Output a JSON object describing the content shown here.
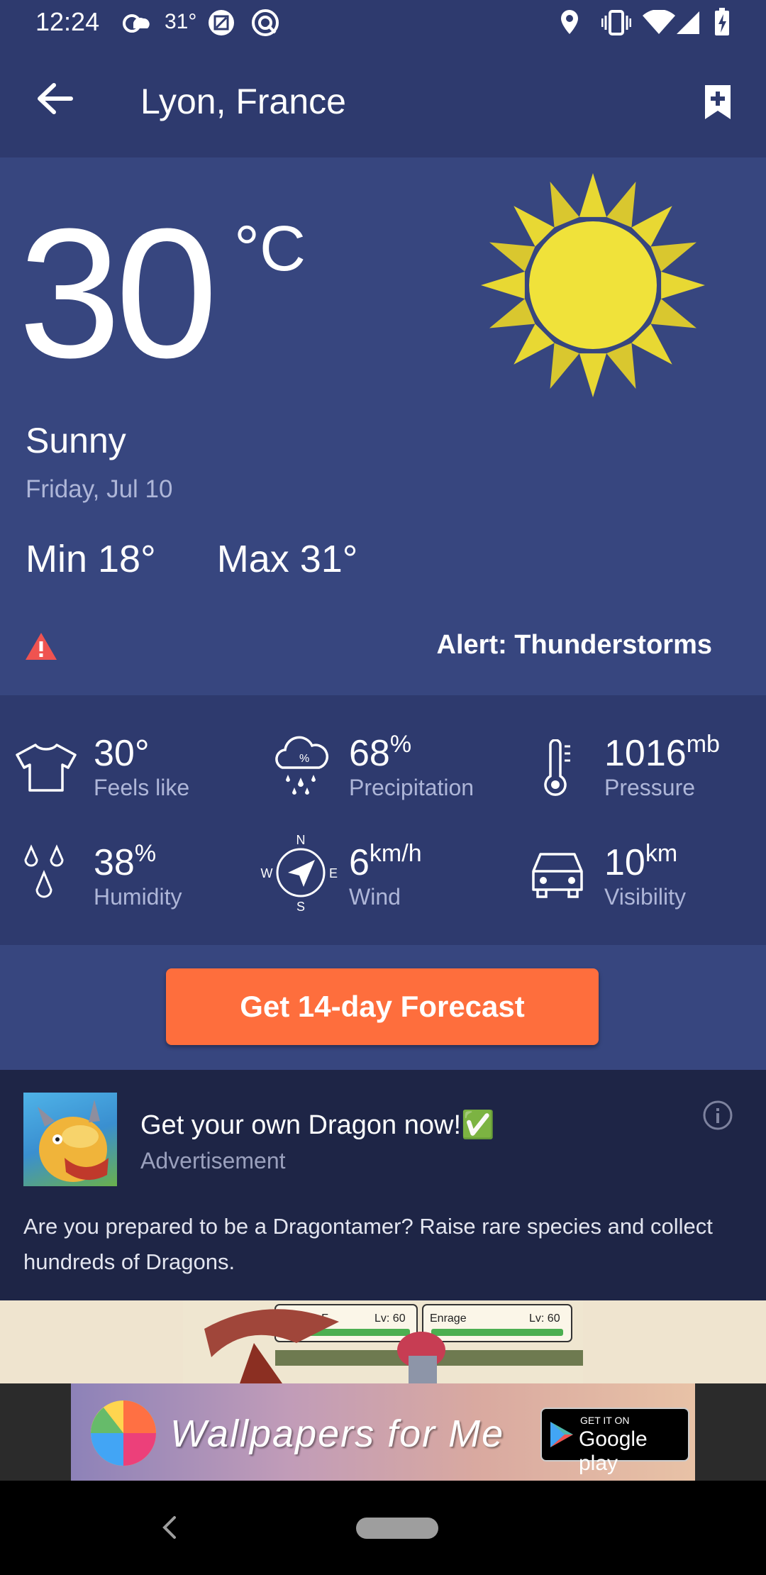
{
  "status_bar": {
    "time": "12:24",
    "temp": "31°"
  },
  "app_bar": {
    "title": "Lyon, France"
  },
  "current": {
    "temperature": "30",
    "unit": "°C",
    "condition": "Sunny",
    "date": "Friday, Jul 10",
    "min": "Min 18°",
    "max": "Max 31°",
    "alert": "Alert: Thunderstorms"
  },
  "metrics": [
    {
      "value": "30°",
      "unit": "",
      "label": "Feels like"
    },
    {
      "value": "68",
      "unit": "%",
      "label": "Precipitation"
    },
    {
      "value": "1016",
      "unit": "mb",
      "label": "Pressure"
    },
    {
      "value": "38",
      "unit": "%",
      "label": "Humidity"
    },
    {
      "value": "6",
      "unit": "km/h",
      "label": "Wind"
    },
    {
      "value": "10",
      "unit": "km",
      "label": "Visibility"
    }
  ],
  "compass": {
    "n": "N",
    "s": "S",
    "e": "E",
    "w": "W"
  },
  "forecast_button": "Get 14-day Forecast",
  "ad": {
    "title": "Get your own Dragon now!✅",
    "subtitle": "Advertisement",
    "body": "Are you prepared to be a Dragontamer? Raise rare species and collect hundreds of Dragons.",
    "game_labels": [
      "Raging F",
      "Lv: 60",
      "Enrage",
      "Lv: 60"
    ]
  },
  "banner": {
    "text": "Wallpapers for Me",
    "store_small": "GET IT ON",
    "store_big": "Google play"
  },
  "colors": {
    "background": "#2e3a6e",
    "hero": "#37467f",
    "accent_button": "#fe6e3d",
    "alert_icon": "#ef5350",
    "sun": "#f0e23a"
  }
}
